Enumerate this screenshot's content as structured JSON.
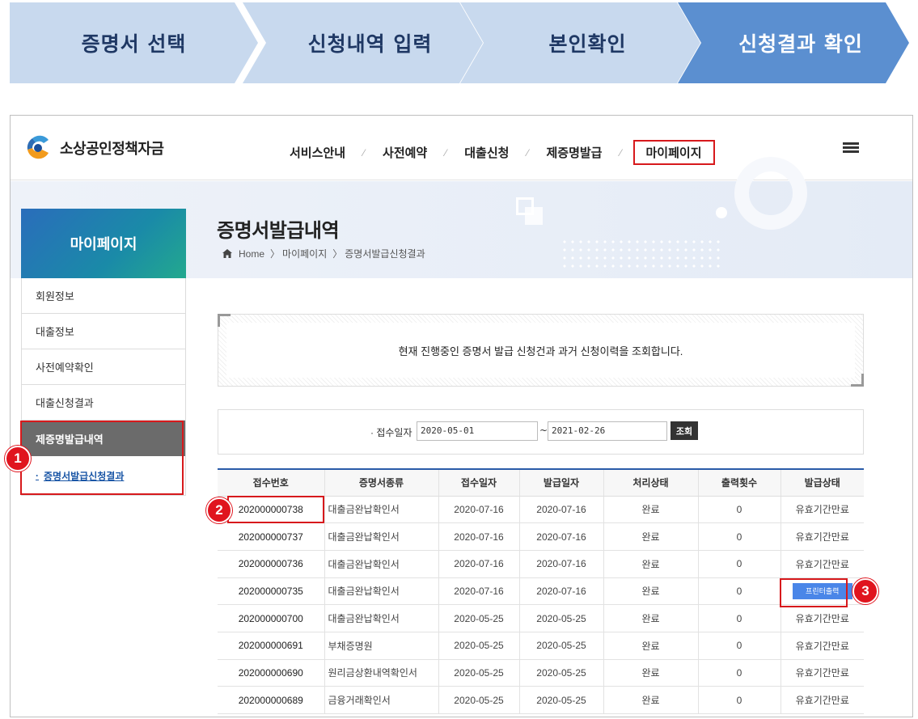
{
  "steps": [
    "증명서 선택",
    "신청내역 입력",
    "본인확인",
    "신청결과 확인"
  ],
  "header": {
    "logo_text": "소상공인정책자금",
    "menu": [
      "서비스안내",
      "사전예약",
      "대출신청",
      "제증명발급",
      "마이페이지"
    ]
  },
  "page": {
    "title": "증명서발급내역",
    "breadcrumb": [
      "Home",
      "마이페이지",
      "증명서발급신청결과"
    ]
  },
  "sidebar": {
    "title": "마이페이지",
    "items": [
      "회원정보",
      "대출정보",
      "사전예약확인",
      "대출신청결과",
      "제증명발급내역"
    ],
    "sub_item": "증명서발급신청결과"
  },
  "info": {
    "text": "현재 진행중인 증명서 발급 신청건과 과거 신청이력을 조회합니다."
  },
  "search": {
    "label": "· 접수일자",
    "from": "2020-05-01",
    "tilde": "~",
    "to": "2021-02-26",
    "button": "조회"
  },
  "table": {
    "headers": [
      "접수번호",
      "증명서종류",
      "접수일자",
      "발급일자",
      "처리상태",
      "출력횟수",
      "발급상태"
    ],
    "rows": [
      [
        "202000000738",
        "대출금완납확인서",
        "2020-07-16",
        "2020-07-16",
        "완료",
        "0",
        "유효기간만료"
      ],
      [
        "202000000737",
        "대출금완납확인서",
        "2020-07-16",
        "2020-07-16",
        "완료",
        "0",
        "유효기간만료"
      ],
      [
        "202000000736",
        "대출금완납확인서",
        "2020-07-16",
        "2020-07-16",
        "완료",
        "0",
        "유효기간만료"
      ],
      [
        "202000000735",
        "대출금완납확인서",
        "2020-07-16",
        "2020-07-16",
        "완료",
        "0",
        "프린터출력"
      ],
      [
        "202000000700",
        "대출금완납확인서",
        "2020-05-25",
        "2020-05-25",
        "완료",
        "0",
        "유효기간만료"
      ],
      [
        "202000000691",
        "부채증명원",
        "2020-05-25",
        "2020-05-25",
        "완료",
        "0",
        "유효기간만료"
      ],
      [
        "202000000690",
        "원리금상환내역확인서",
        "2020-05-25",
        "2020-05-25",
        "완료",
        "0",
        "유효기간만료"
      ],
      [
        "202000000689",
        "금융거래확인서",
        "2020-05-25",
        "2020-05-25",
        "완료",
        "0",
        "유효기간만료"
      ]
    ]
  },
  "badges": [
    "1",
    "2",
    "3"
  ],
  "colors": {
    "step_inactive": "#c8d9ee",
    "step_active": "#5b8fd0",
    "highlight": "#d7191c",
    "print_button": "#4a86e8"
  }
}
